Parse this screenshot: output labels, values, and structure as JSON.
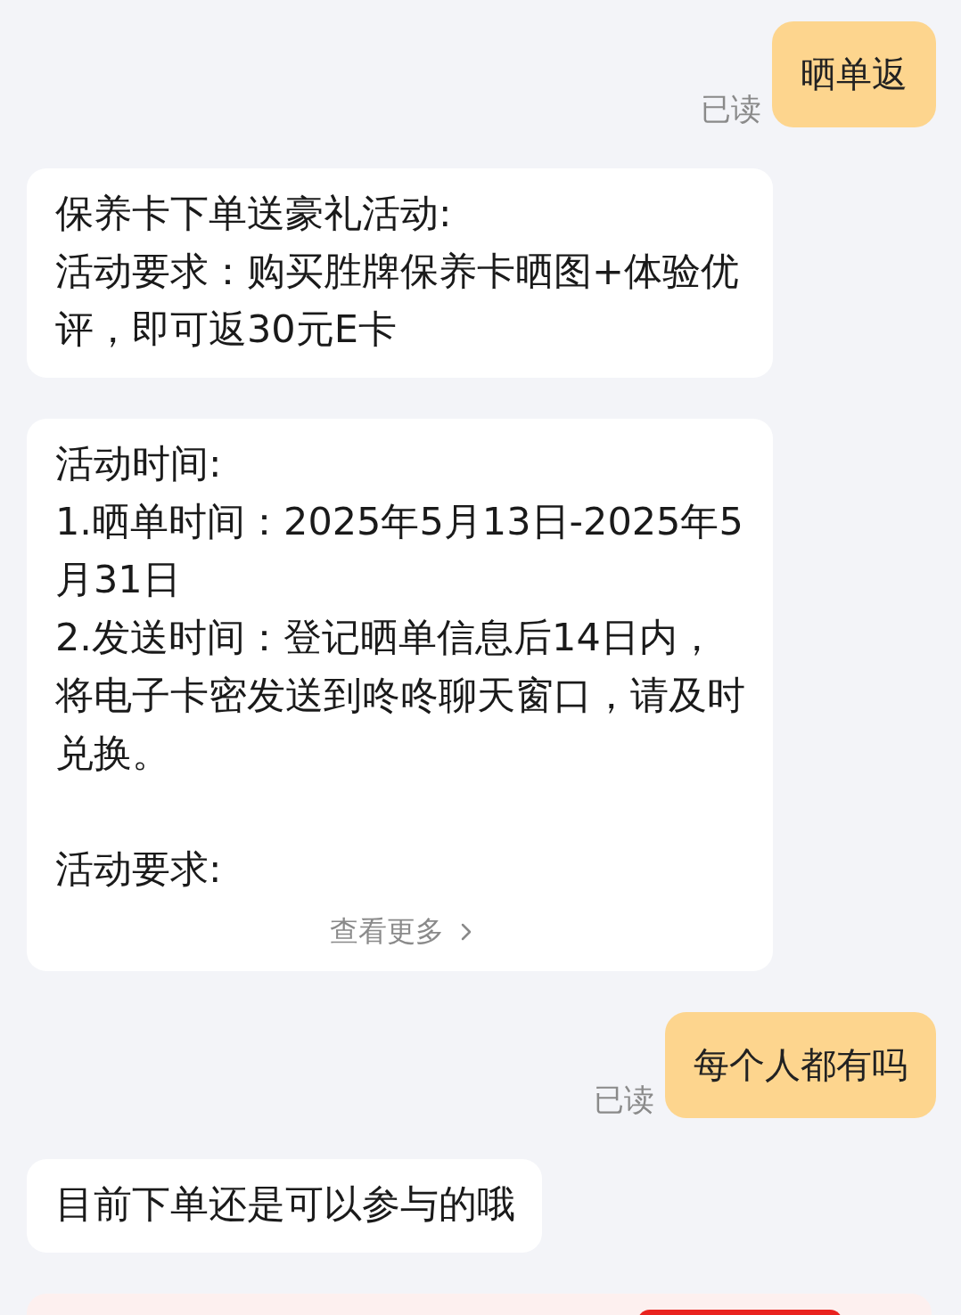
{
  "messages": [
    {
      "kind": "sent",
      "text": "晒单返",
      "status": "已读"
    },
    {
      "kind": "received",
      "paragraphs": [
        "保养卡下单送豪礼活动:\n活动要求：购买胜牌保养卡晒图+体验优评，即可返30元E卡"
      ]
    },
    {
      "kind": "received",
      "paragraphs": [
        "活动时间:\n1.晒单时间：2025年5月13日-2025年5月31日\n2.发送时间：登记晒单信息后14日内，将电子卡密发送到咚咚聊天窗口，请及时兑换。",
        "活动要求:"
      ],
      "more": "查看更多"
    },
    {
      "kind": "sent",
      "text": "每个人都有吗",
      "status": "已读"
    },
    {
      "kind": "received",
      "paragraphs": [
        "目前下单还是可以参与的哦"
      ]
    },
    {
      "kind": "card"
    }
  ]
}
